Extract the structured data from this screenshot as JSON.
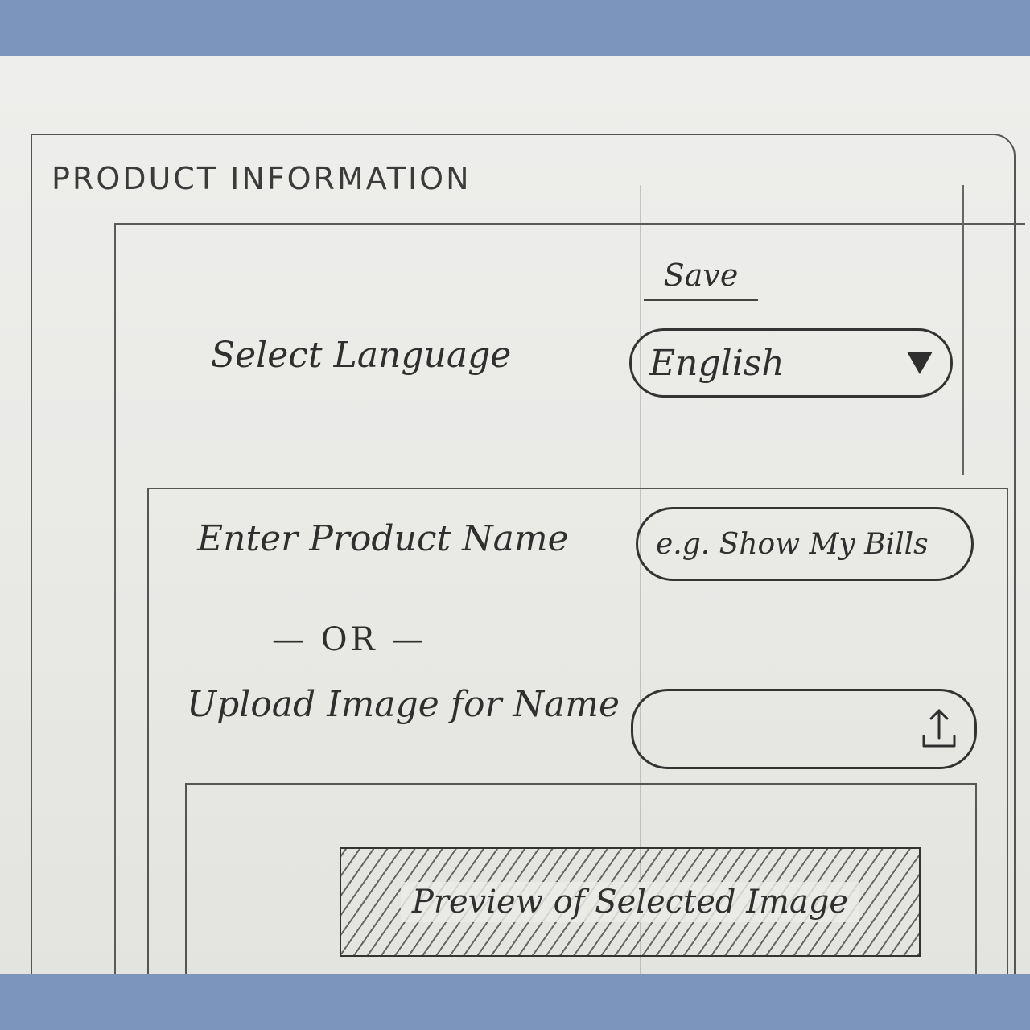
{
  "title": "PRODUCT INFORMATION",
  "toolbar": {
    "save_label": "Save"
  },
  "language": {
    "label": "Select Language",
    "selected": "English"
  },
  "product_name": {
    "label": "Enter Product Name",
    "placeholder": "e.g. Show My Bills"
  },
  "separator": "— OR —",
  "upload": {
    "label": "Upload Image for Name",
    "icon": "upload-icon"
  },
  "preview": {
    "label": "Preview of Selected Image"
  }
}
